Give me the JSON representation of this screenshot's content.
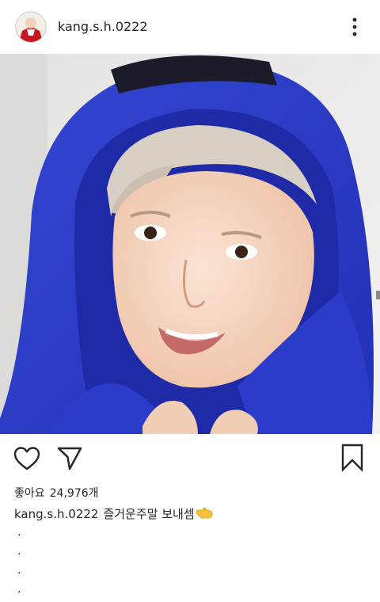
{
  "post": {
    "username": "kang.s.h.0222",
    "likes_label": "좋아요",
    "likes_count": "24,976개",
    "caption_user": "kang.s.h.0222",
    "caption_text": "즐거운주말 보내셈",
    "caption_emoji": "backhand-index-pointing-left-emoji",
    "continuation_dots": [
      ".",
      ".",
      ".",
      "."
    ]
  },
  "icons": {
    "more": "vertical-ellipsis-icon",
    "like": "heart-outline-icon",
    "share": "paper-plane-icon",
    "save": "bookmark-outline-icon"
  },
  "colors": {
    "hoodie_blue": "#2f3fcf",
    "text": "#262626",
    "background": "#ffffff"
  }
}
